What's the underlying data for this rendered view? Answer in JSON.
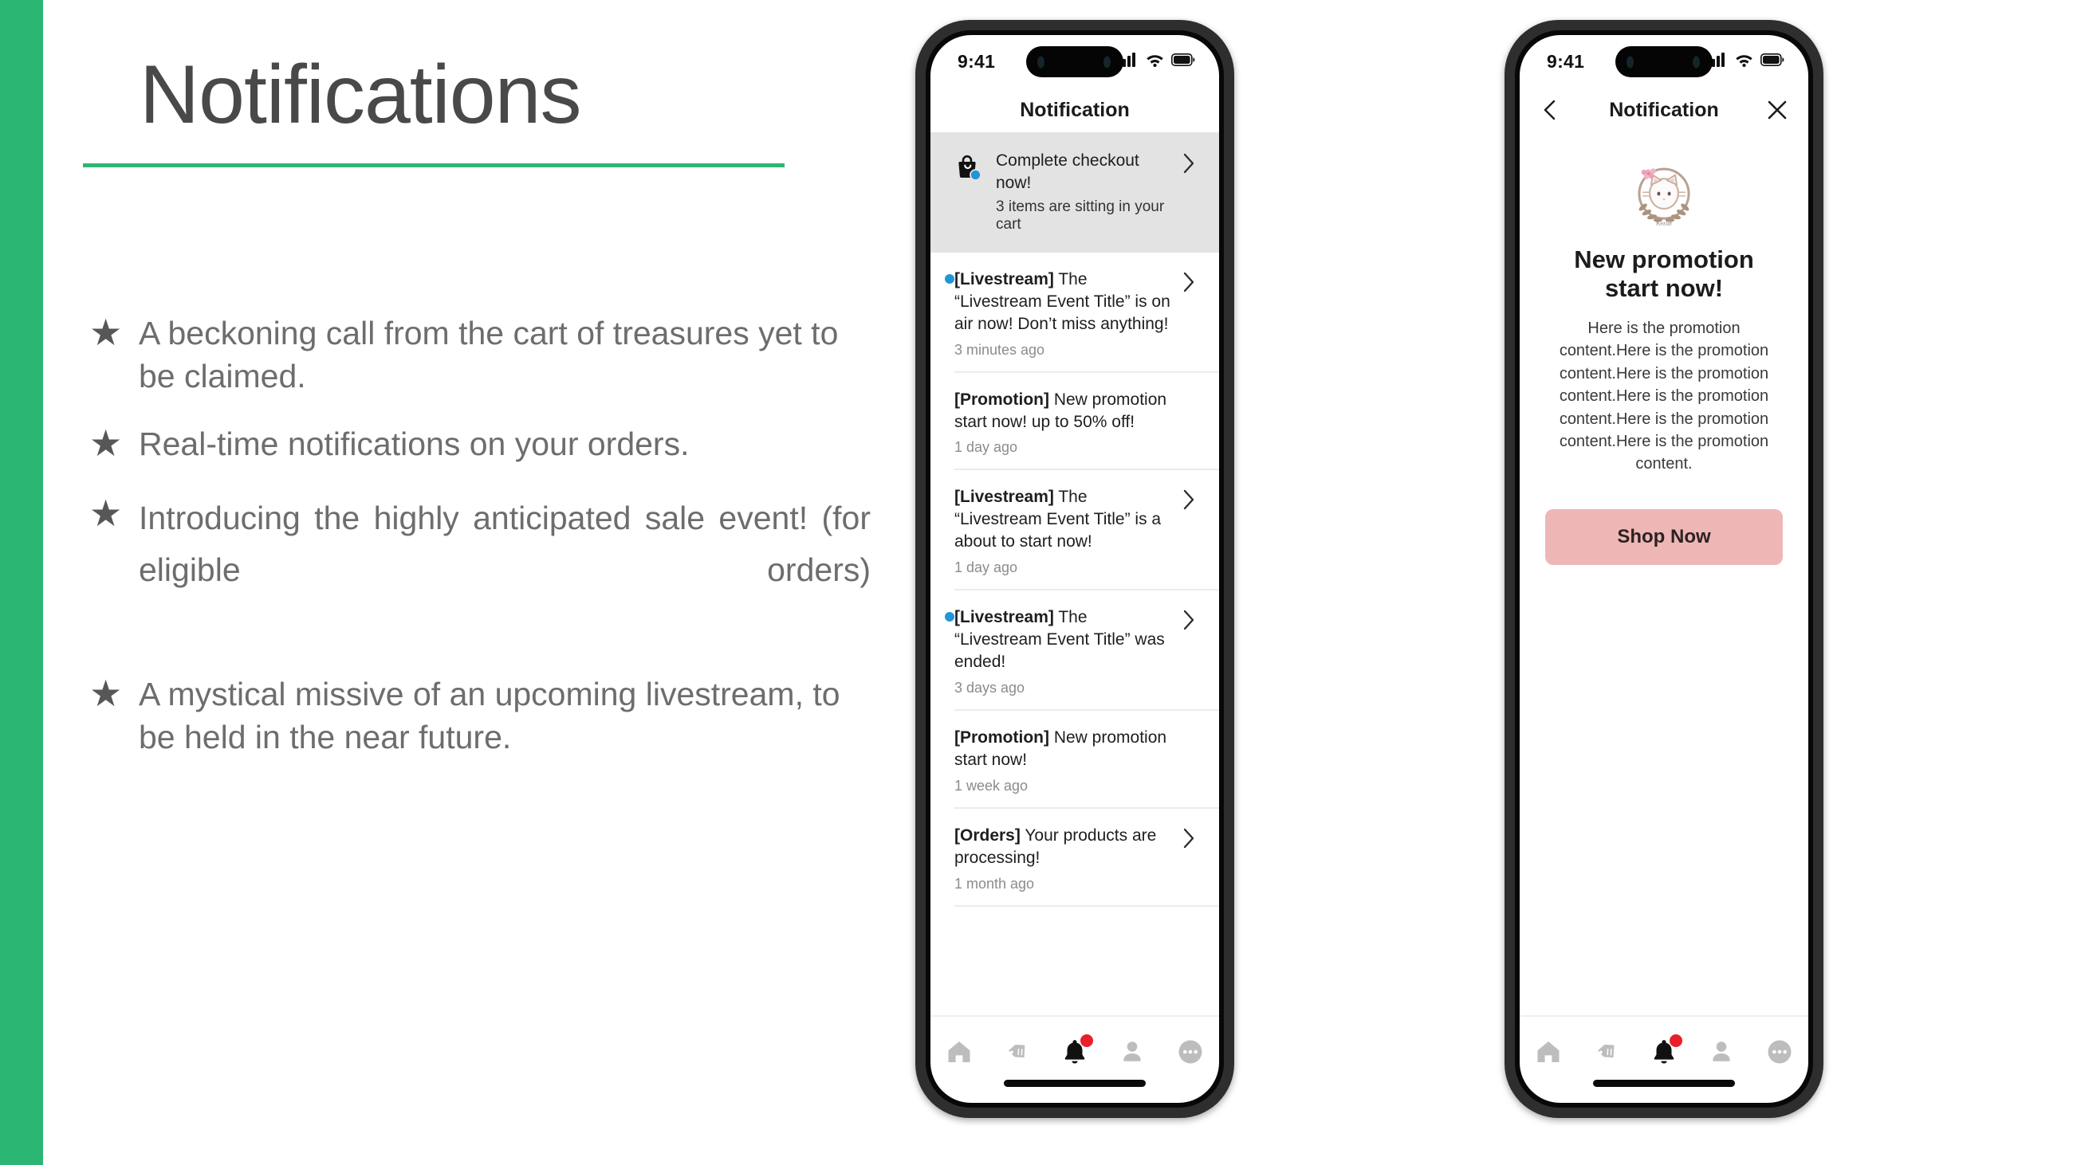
{
  "slide": {
    "title": "Notifications",
    "accent_color": "#2bb573",
    "rule_color": "#2eb574",
    "bullet_glyph": "★",
    "bullets": [
      {
        "text": "A beckoning call from the cart of treasures yet to be claimed.",
        "justify": false
      },
      {
        "text": "Real-time notifications on your orders.",
        "justify": false
      },
      {
        "text": "Introducing the highly anticipated sale event! (for eligible orders)",
        "justify": true
      },
      {
        "text": "A mystical missive of an upcoming livestream, to be held in the near future.",
        "justify": false
      }
    ]
  },
  "phone_list": {
    "status_bar": {
      "time": "9:41",
      "signal_icon": "cellular-signal-icon",
      "wifi_icon": "wifi-icon",
      "battery_icon": "battery-full-icon"
    },
    "nav": {
      "title": "Notification"
    },
    "highlight_row": {
      "icon": "shopping-bag-icon",
      "badge_color": "#2196d6",
      "title": "Complete checkout now!",
      "subtitle": "3 items are sitting in your cart",
      "chevron": "chevron-right-icon"
    },
    "items": [
      {
        "tag": "[Livestream]",
        "text": " The “Livestream Event Title” is on air now! Don’t miss anything!",
        "time": "3 minutes ago",
        "unread": true,
        "chevron": true
      },
      {
        "tag": "[Promotion]",
        "text": " New promotion start now! up to 50% off!",
        "time": "1 day ago",
        "unread": false,
        "chevron": false
      },
      {
        "tag": "[Livestream]",
        "text": " The “Livestream Event Title” is a about to start now!",
        "time": "1 day ago",
        "unread": false,
        "chevron": true
      },
      {
        "tag": "[Livestream]",
        "text": " The “Livestream Event Title” was ended!",
        "time": "3 days ago",
        "unread": true,
        "chevron": true
      },
      {
        "tag": "[Promotion]",
        "text": " New promotion start now!",
        "time": "1 week ago",
        "unread": false,
        "chevron": false
      },
      {
        "tag": "[Orders]",
        "text": " Your products are processing!",
        "time": "1 month ago",
        "unread": false,
        "chevron": true
      }
    ]
  },
  "phone_detail": {
    "status_bar": {
      "time": "9:41",
      "signal_icon": "cellular-signal-icon",
      "wifi_icon": "wifi-icon",
      "battery_icon": "battery-full-icon"
    },
    "nav": {
      "title": "Notification",
      "back_icon": "chevron-left-icon",
      "close_icon": "close-x-icon"
    },
    "promotion": {
      "logo_icon": "cat-wreath-brand-logo",
      "title": "New promotion start now!",
      "body": "Here is the promotion content.Here is the promotion content.Here is the promotion content.Here is the promotion content.Here is the promotion content.Here is the promotion content.",
      "cta_label": "Shop Now",
      "cta_color": "#eeb7b6"
    }
  },
  "tabbar": {
    "items": [
      {
        "icon": "home-icon",
        "active": false
      },
      {
        "icon": "tag-icon",
        "active": false
      },
      {
        "icon": "bell-icon",
        "active": true,
        "badge": true
      },
      {
        "icon": "person-icon",
        "active": false
      },
      {
        "icon": "more-ellipsis-icon",
        "active": false
      }
    ],
    "badge_color": "#e8202a",
    "active_color": "#111111",
    "inactive_color": "#bdbdbd"
  }
}
